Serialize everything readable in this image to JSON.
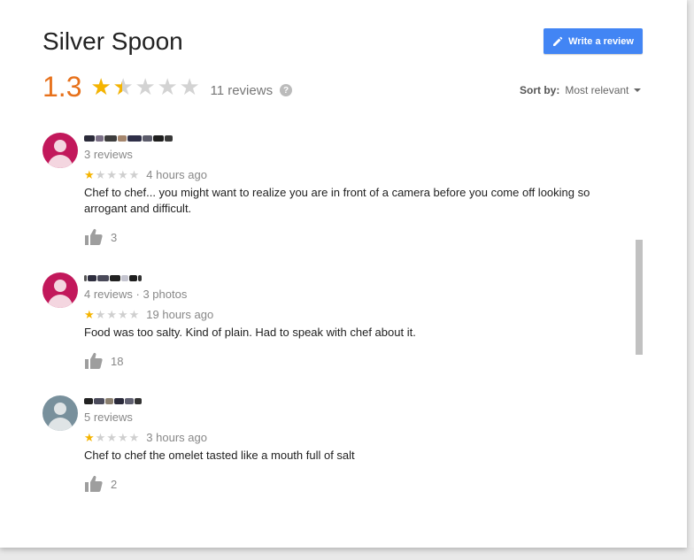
{
  "place": {
    "name": "Silver Spoon"
  },
  "header": {
    "write_review_label": "Write a review",
    "rating": "1.3",
    "rating_value": 1.3,
    "review_count_label": "11 reviews",
    "help_label": "?",
    "sort_label": "Sort by:",
    "sort_value": "Most relevant"
  },
  "colors": {
    "accent": "#4285f4",
    "rating": "#e7711b",
    "star": "#f5b400",
    "avatar_pink": "#d81b60",
    "avatar_gray": "#78909c"
  },
  "reviews": [
    {
      "avatar_color": "#c2185b",
      "meta": "3 reviews",
      "stars": 1,
      "time": "4 hours ago",
      "text": "Chef to chef... you might want to realize you are in front of a camera before you come off looking so arrogant and difficult.",
      "likes": "3"
    },
    {
      "avatar_color": "#c2185b",
      "meta": "4 reviews · 3 photos",
      "stars": 1,
      "time": "19 hours ago",
      "text": "Food was too salty.  Kind of plain.  Had to speak with chef about it.",
      "likes": "18"
    },
    {
      "avatar_color": "#78909c",
      "meta": "5 reviews",
      "stars": 1,
      "time": "3 hours ago",
      "text": "Chef to chef the omelet tasted like a mouth full of salt",
      "likes": "2"
    }
  ]
}
